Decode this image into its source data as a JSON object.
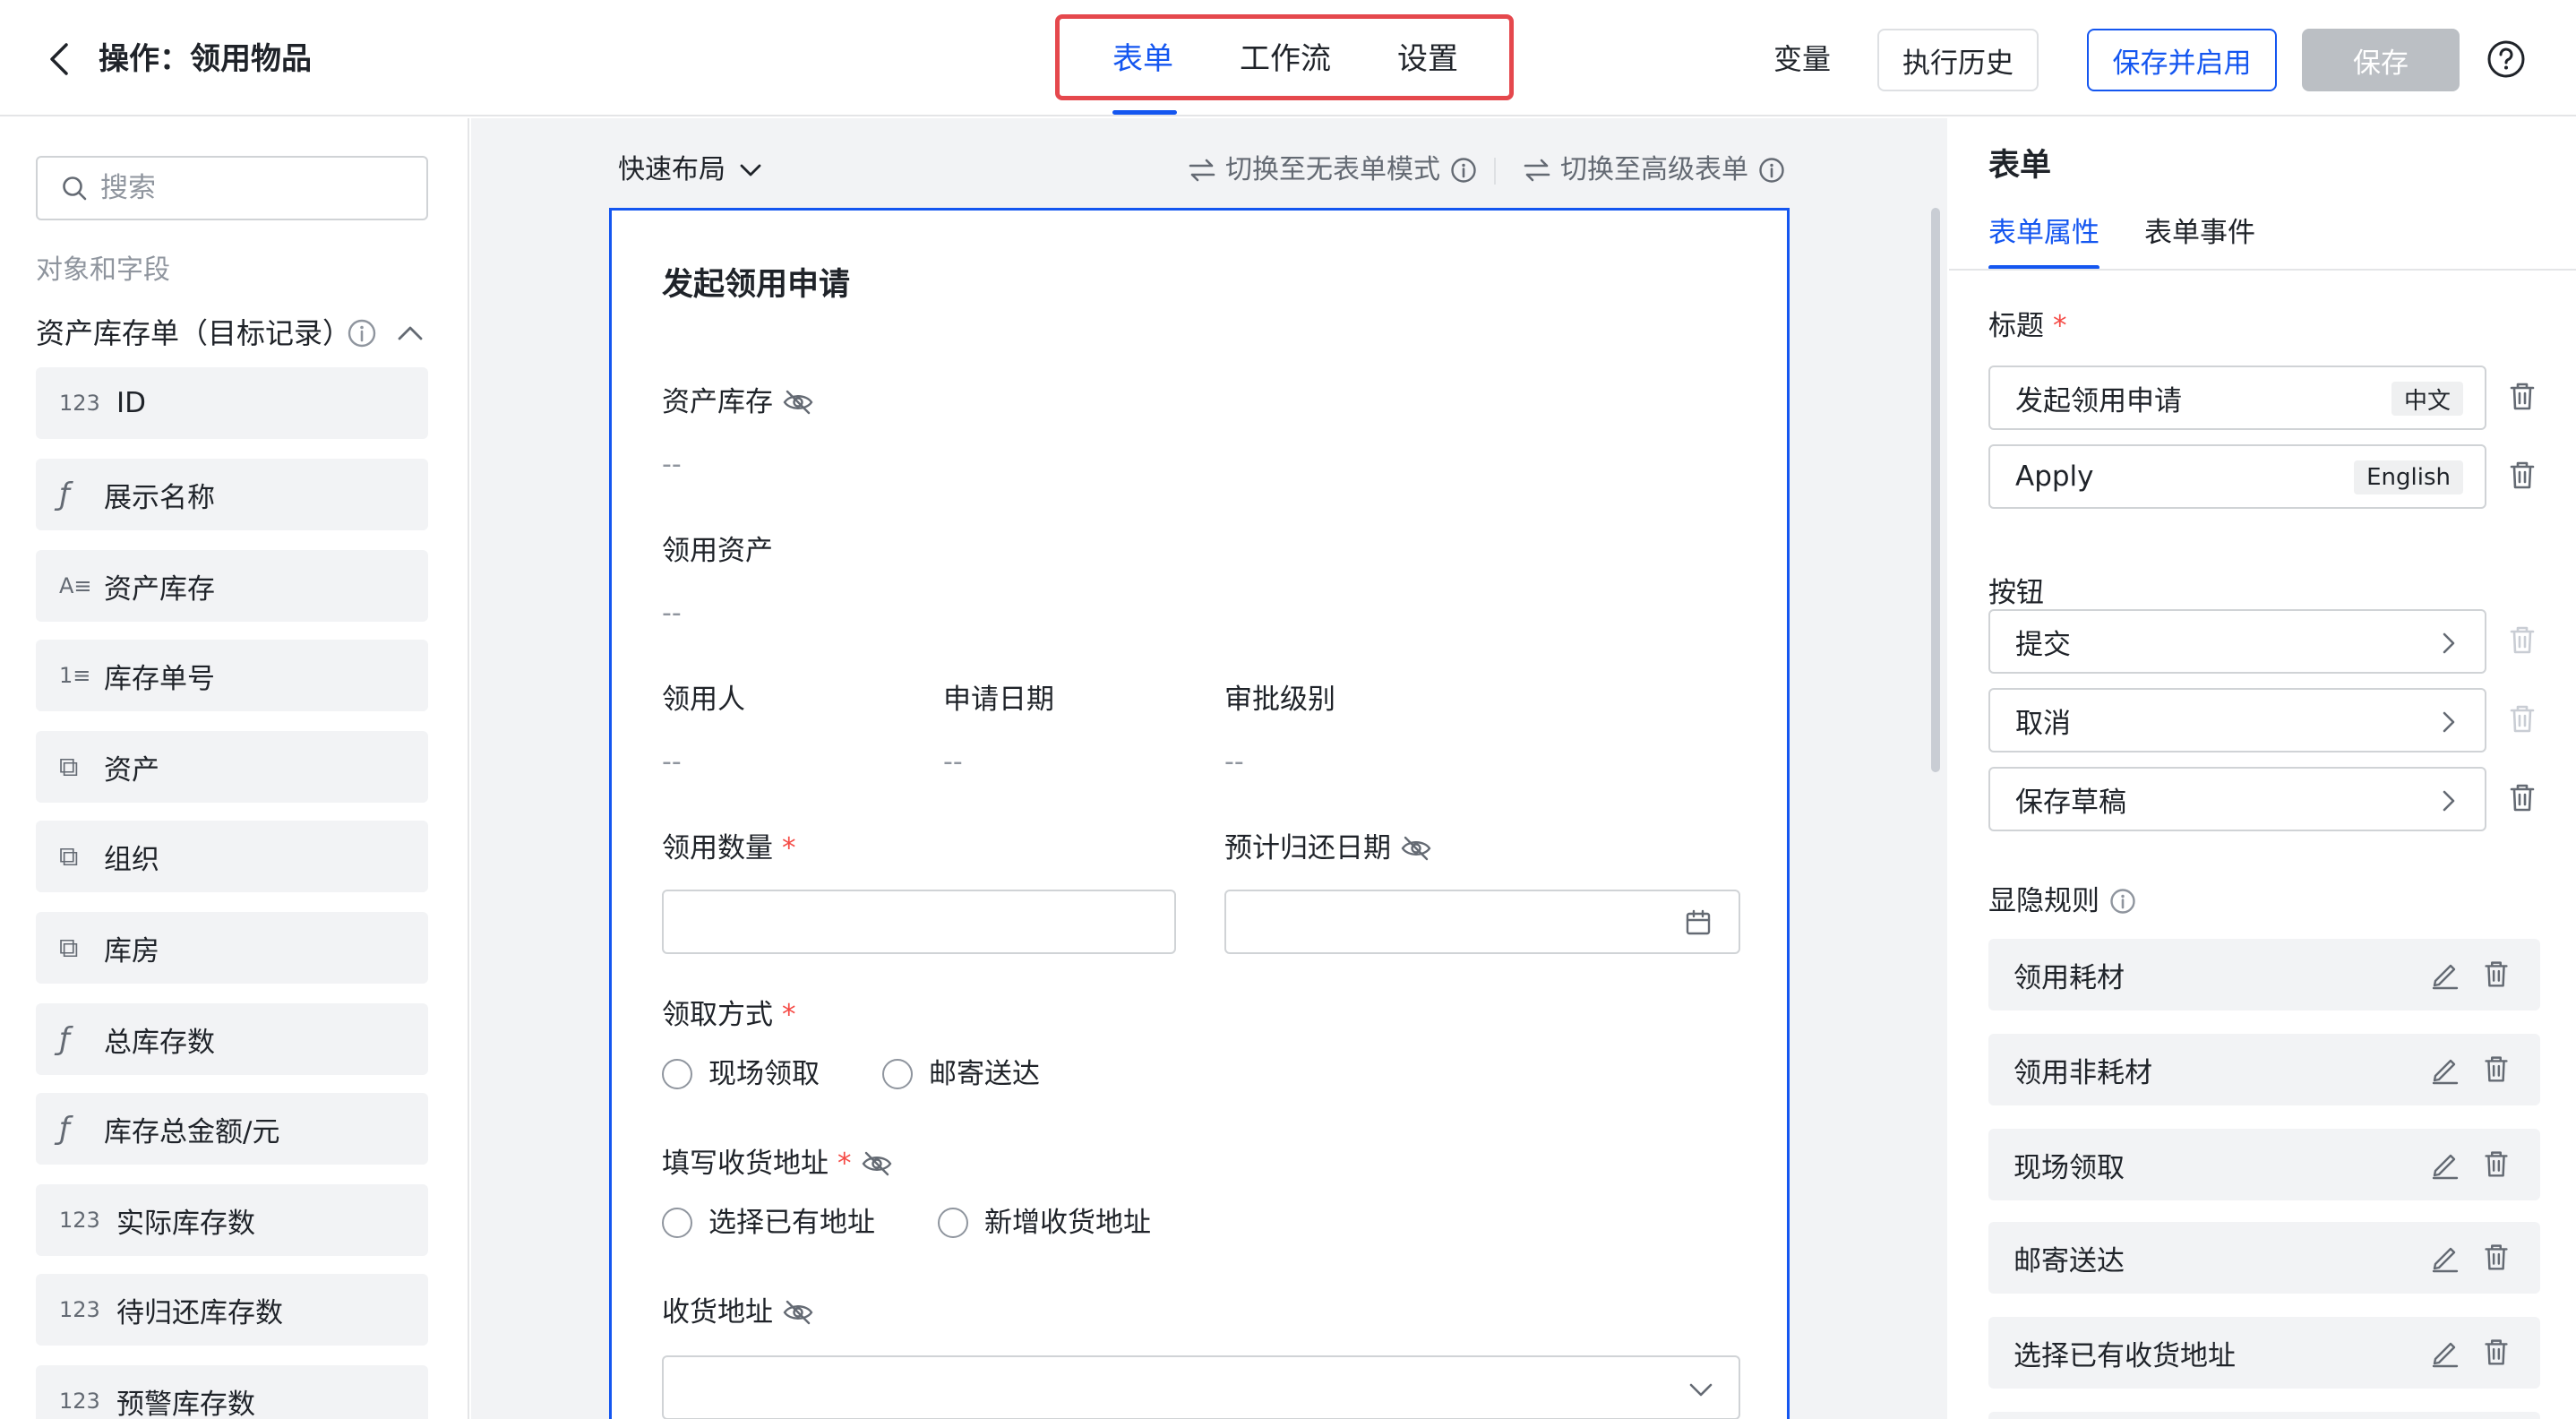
{
  "header": {
    "title": "操作：领用物品",
    "tabs": [
      "表单",
      "工作流",
      "设置"
    ],
    "variables": "变量",
    "history": "执行历史",
    "save_enable": "保存并启用",
    "save": "保存"
  },
  "left": {
    "search_placeholder": "搜索",
    "section": "对象和字段",
    "group": "资产库存单（目标记录）",
    "fields": [
      {
        "icon": "123",
        "label": "ID"
      },
      {
        "icon": "ƒ",
        "label": "展示名称"
      },
      {
        "icon": "A≡",
        "label": "资产库存"
      },
      {
        "icon": "1≡",
        "label": "库存单号"
      },
      {
        "icon": "⧉",
        "label": "资产"
      },
      {
        "icon": "⧉",
        "label": "组织"
      },
      {
        "icon": "⧉",
        "label": "库房"
      },
      {
        "icon": "ƒ",
        "label": "总库存数"
      },
      {
        "icon": "ƒ",
        "label": "库存总金额/元"
      },
      {
        "icon": "123",
        "label": "实际库存数"
      },
      {
        "icon": "123",
        "label": "待归还库存数"
      },
      {
        "icon": "123",
        "label": "预警库存数"
      }
    ]
  },
  "canvas": {
    "quick_layout": "快速布局",
    "switch_no_form": "切换至无表单模式",
    "switch_advanced": "切换至高级表单",
    "form_title": "发起领用申请",
    "f_asset_stock": "资产库存",
    "f_asset": "领用资产",
    "f_user": "领用人",
    "f_date": "申请日期",
    "f_level": "审批级别",
    "f_qty": "领用数量",
    "f_return": "预计归还日期",
    "f_method": "领取方式",
    "method_options": [
      "现场领取",
      "邮寄送达"
    ],
    "f_address_fill": "填写收货地址",
    "address_options": [
      "选择已有地址",
      "新增收货地址"
    ],
    "f_address": "收货地址",
    "empty": "--"
  },
  "right": {
    "title": "表单",
    "tabs": [
      "表单属性",
      "表单事件"
    ],
    "title_label": "标题",
    "title_zh": "发起领用申请",
    "lang_zh": "中文",
    "title_en": "Apply",
    "lang_en": "English",
    "buttons_label": "按钮",
    "buttons": [
      "提交",
      "取消",
      "保存草稿"
    ],
    "rules_label": "显隐规则",
    "rules": [
      "领用耗材",
      "领用非耗材",
      "现场领取",
      "邮寄送达",
      "选择已有收货地址"
    ]
  }
}
